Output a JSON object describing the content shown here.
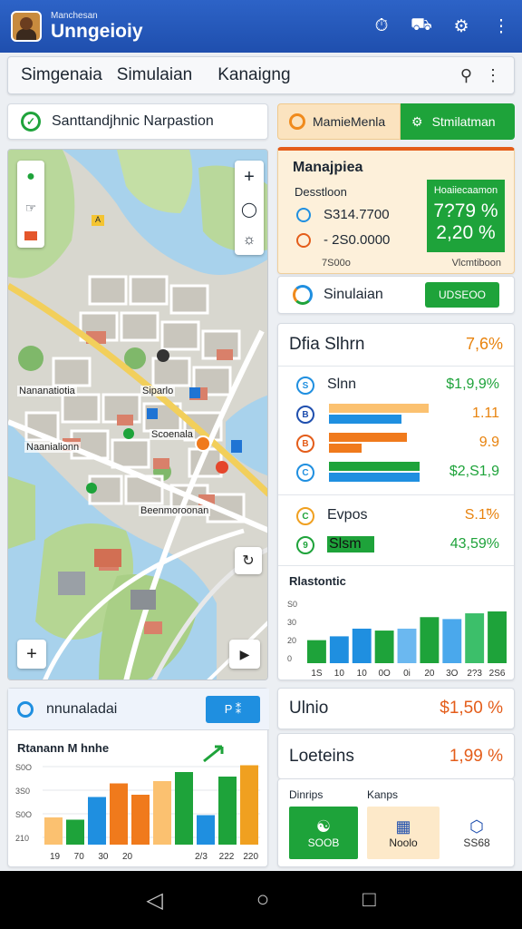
{
  "app": {
    "subtitle": "Manchesan",
    "title": "Unngeioiy"
  },
  "menu": {
    "items": [
      "Simgenaia",
      "Simulaian",
      "Kanaigng"
    ]
  },
  "route": {
    "label": "Santtandjhnic Narpastion"
  },
  "mode": {
    "left_label": "MamieMenla",
    "right_label": "Stmilatman"
  },
  "map": {
    "labels": [
      "Nananatiotia",
      "Siparlo",
      "Scoenala",
      "Naanialionn",
      "Beenmoroonan"
    ],
    "badge": "A"
  },
  "summary": {
    "title": "Manajpiea",
    "label": "Desstloon",
    "values": [
      "S314.7700",
      "- 2S0.0000"
    ],
    "foot_left": "7S00o",
    "foot_right": "Vlcmtiboon",
    "box_header": "Hoaiiecaamon",
    "box_values": [
      "7?79 %",
      "2,20 %"
    ]
  },
  "simulation": {
    "label": "Sinulaian",
    "button": "UDSEOO"
  },
  "stats": {
    "title": "Dfia Slhrn",
    "title_value": "7,6%",
    "rows": [
      {
        "label": "Slnn",
        "value": "$1,9,9%",
        "icon": "S"
      },
      {
        "label": "",
        "value": "1.11",
        "icon": "B"
      },
      {
        "label": "",
        "value": "9.9",
        "icon": "B"
      },
      {
        "label": "",
        "value": "$2,S1,9",
        "icon": "C"
      },
      {
        "label": "Evpos",
        "value": "S.1̃%",
        "icon": "C"
      },
      {
        "label": "Slsm",
        "value": "43,59%",
        "icon": "9"
      }
    ],
    "trend_title": "Rlastontic",
    "trend_y": [
      "S0",
      "30",
      "20",
      "0"
    ],
    "trend_x": [
      "1S",
      "10",
      "10",
      "0O",
      "0i",
      "20",
      "3O",
      "2?3",
      "2S6"
    ]
  },
  "bottom_left": {
    "title": "nnunaladai",
    "button": "P ⁑",
    "chart_title": "Rtanann M hnhe",
    "y_ticks": [
      "S0O",
      "3S0",
      "S0O",
      "210"
    ],
    "x_ticks": [
      "19",
      "70",
      "30",
      "20",
      "",
      "",
      "2/3",
      "222",
      "220"
    ]
  },
  "metrics": [
    {
      "label": "Ulnio",
      "value": "$1,50 %"
    },
    {
      "label": "Loeteins",
      "value": "1,99 %"
    }
  ],
  "actions": {
    "label_left": "Dinrips",
    "label_right": "Kanps",
    "buttons": [
      "SOOB",
      "Noolo",
      "SS68"
    ]
  },
  "colors": {
    "primary": "#2d63c7",
    "green": "#1ea33a",
    "orange": "#f07a1c",
    "blue": "#1f8fe0",
    "light_orange": "#fbc170"
  },
  "chart_data": [
    {
      "type": "bar",
      "title": "Rlastontic",
      "categories": [
        "1S",
        "10",
        "10",
        "0O",
        "0i",
        "20",
        "3O",
        "2?3",
        "2S6"
      ],
      "values": [
        12,
        14,
        18,
        17,
        18,
        24,
        23,
        26,
        27
      ],
      "ylim": [
        0,
        35
      ]
    },
    {
      "type": "bar",
      "title": "Rtanann M hnhe",
      "categories": [
        "19",
        "70",
        "30",
        "20",
        "",
        "",
        "2/3",
        "222",
        "220"
      ],
      "values": [
        120,
        110,
        210,
        270,
        220,
        280,
        320,
        130,
        300,
        350
      ],
      "ylim": [
        0,
        400
      ]
    }
  ]
}
